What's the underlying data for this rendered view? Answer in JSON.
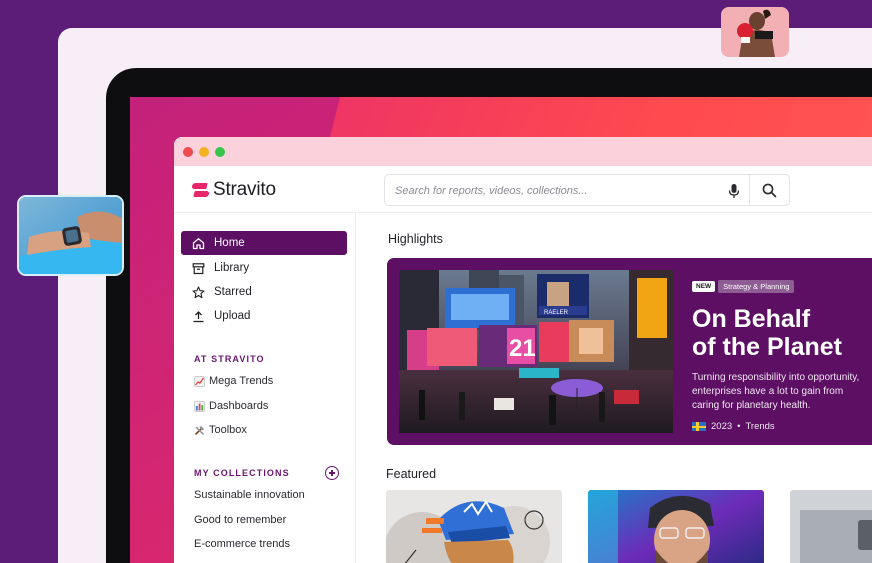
{
  "browser": {
    "window_controls": [
      "close",
      "minimize",
      "maximize"
    ]
  },
  "app": {
    "brand": "Stravito",
    "search_placeholder": "Search for reports, videos, collections..."
  },
  "sidebar": {
    "nav": [
      {
        "label": "Home",
        "icon": "home-icon",
        "active": true
      },
      {
        "label": "Library",
        "icon": "archive-icon",
        "active": false
      },
      {
        "label": "Starred",
        "icon": "star-icon",
        "active": false
      },
      {
        "label": "Upload",
        "icon": "upload-icon",
        "active": false
      }
    ],
    "at_section_label": "AT STRAVITO",
    "at_items": [
      {
        "label": "Mega Trends",
        "icon": "chart-increasing-emoji"
      },
      {
        "label": "Dashboards",
        "icon": "bar-chart-emoji"
      },
      {
        "label": "Toolbox",
        "icon": "tools-emoji"
      }
    ],
    "collections_label": "MY COLLECTIONS",
    "collections": [
      "Sustainable innovation",
      "Good to remember",
      "E-commerce trends"
    ]
  },
  "main": {
    "highlights_title": "Highlights",
    "featured_title": "Featured",
    "hero": {
      "badge": "NEW",
      "category": "Strategy & Planning",
      "title_line1": "On Behalf",
      "title_line2": "of the Planet",
      "desc_line1": "Turning responsibility into opportunity,",
      "desc_line2": "enterprises have a lot to gain from",
      "desc_line3": "caring for planetary health.",
      "year": "2023",
      "separator": "•",
      "tag": "Trends"
    },
    "billboard_texts": [
      "RAELER",
      "21"
    ]
  },
  "colors": {
    "background": "#5b1d78",
    "brand_pink": "#e8266b",
    "brand_purple": "#5c0f63",
    "screen_gradient_start": "#e3287c",
    "screen_gradient_end": "#ff5a55"
  }
}
